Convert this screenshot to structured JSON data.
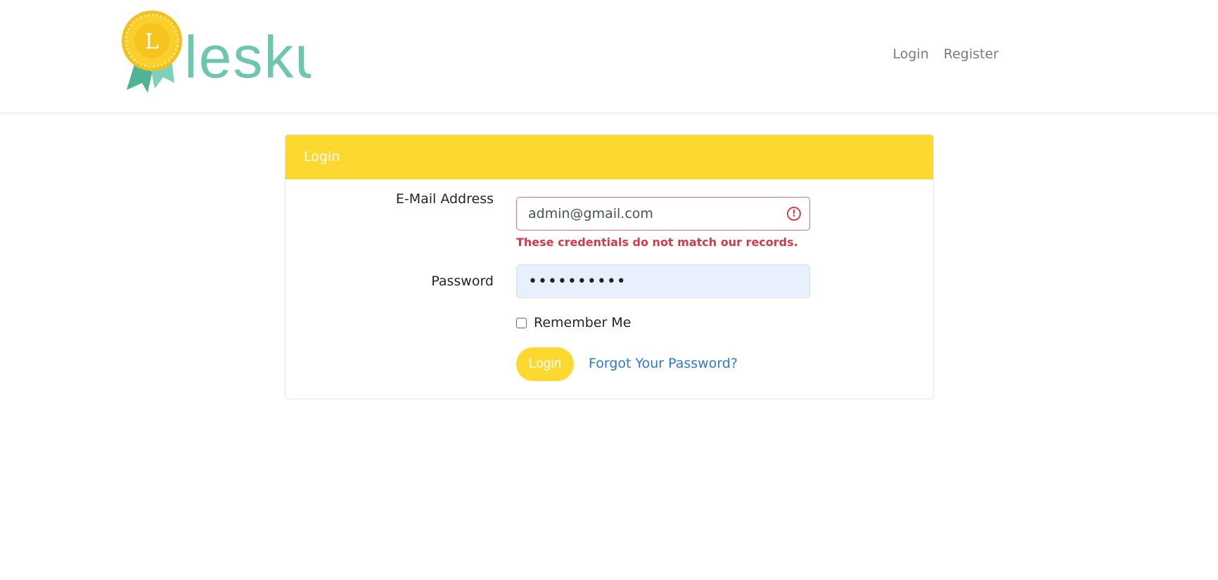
{
  "brand": {
    "logo_letter": "L",
    "logo_text": "lesku",
    "colors": {
      "medal": "#f7c925",
      "ribbon": "#52b99a",
      "text": "#6cc7ad"
    }
  },
  "nav": {
    "links": [
      {
        "label": "Login"
      },
      {
        "label": "Register"
      }
    ]
  },
  "card": {
    "header": "Login",
    "email": {
      "label": "E-Mail Address",
      "value": "admin@gmail.com",
      "error": "These credentials do not match our records.",
      "error_icon": "exclamation-circle-icon"
    },
    "password": {
      "label": "Password",
      "value": "••••••••••"
    },
    "remember_label": "Remember Me",
    "remember_checked": false,
    "submit_label": "Login",
    "forgot_label": "Forgot Your Password?"
  },
  "colors": {
    "accent": "#fdd82f",
    "error": "#d33a4a",
    "link": "#2a7bd0"
  }
}
